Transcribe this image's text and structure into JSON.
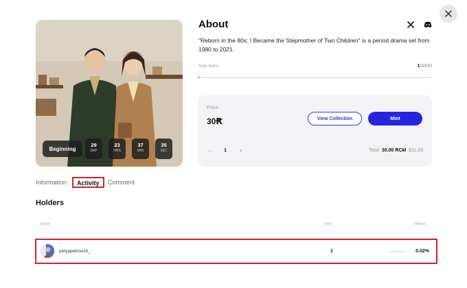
{
  "close_label": "close",
  "hero": {
    "stage": "Beginning",
    "timer": [
      {
        "value": "29",
        "unit": "DAY"
      },
      {
        "value": "23",
        "unit": "HRS"
      },
      {
        "value": "37",
        "unit": "MIN"
      },
      {
        "value": "35",
        "unit": "SEC"
      }
    ]
  },
  "about": {
    "title": "About",
    "description": "\"Reborn in the 80s: I Became the Stepmother of Two Children\" is a period drama set from 1980 to 2021.",
    "total_items_label": "Total Items",
    "minted_count": "1",
    "total_count": "/4400",
    "progress_fraction": 0.0002
  },
  "price_card": {
    "price_label": "Price",
    "price_value": "30Ꞧ",
    "view_collection_label": "View Collection",
    "mint_label": "Mint",
    "qty_minus": "−",
    "qty_value": "1",
    "qty_plus": "+",
    "total_label": "Total",
    "total_amount": "30.00 RCM",
    "total_usd": "$11.83"
  },
  "tabs": [
    {
      "label": "Information",
      "active": false
    },
    {
      "label": "Activity",
      "active": true
    },
    {
      "label": "Comment",
      "active": false
    }
  ],
  "holders": {
    "title": "Holders",
    "columns": {
      "owner": "Owner",
      "held": "Held",
      "minted": "Minted"
    },
    "rows": [
      {
        "owner": "petyapetrovich_",
        "held": "1",
        "minted": "0.02%"
      }
    ]
  },
  "colors": {
    "accent": "#2525e0",
    "highlight": "#d6202a"
  }
}
